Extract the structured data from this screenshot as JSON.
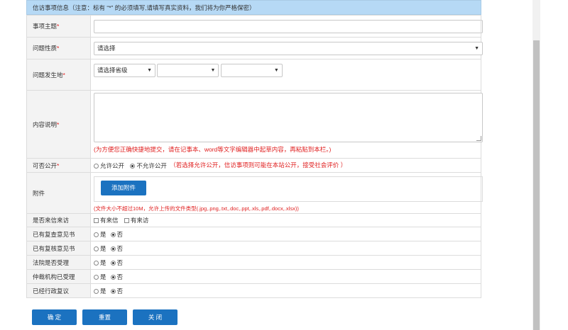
{
  "header": {
    "title": "信访事项信息（注意：标有 “*” 的必须填写,请填写真实资料，我们将为你严格保密）"
  },
  "fields": {
    "subject": {
      "label": "事项主题",
      "required": "*"
    },
    "nature": {
      "label": "问题性质",
      "required": "*",
      "selected": "请选择"
    },
    "location": {
      "label": "问题发生地",
      "required": "*",
      "province": "请选择省级",
      "city": "",
      "district": ""
    },
    "content": {
      "label": "内容说明",
      "required": "*",
      "hint": "(为方便您正确快捷地提交，请在记事本、word等文字编辑器中起草内容，再粘贴到本栏。)"
    },
    "public": {
      "label": "可否公开",
      "required": "*",
      "option_yes": "允许公开",
      "option_no": "不允许公开",
      "hint": "（若选择允许公开，信访事项则可能在本站公开，接受社会评价 ）"
    },
    "attachment": {
      "label": "附件",
      "button": "添加附件",
      "hint": "(文件大小不超过10M，允许上传的文件类型(.jpg,.png,.txt,.doc,.ppt,.xls,.pdf,.docx,.xlsx))"
    },
    "visited": {
      "label": "是否来信来访",
      "option_letter": "有来信",
      "option_visit": "有来访"
    }
  },
  "yes_no_rows": [
    {
      "label": "已有复查意见书",
      "yes": "是",
      "no": "否"
    },
    {
      "label": "已有复核意见书",
      "yes": "是",
      "no": "否"
    },
    {
      "label": "法院是否受理",
      "yes": "是",
      "no": "否"
    },
    {
      "label": "仲裁机构已受理",
      "yes": "是",
      "no": "否"
    },
    {
      "label": "已经行政复议",
      "yes": "是",
      "no": "否"
    }
  ],
  "buttons": {
    "confirm": "确 定",
    "reset": "重置",
    "close": "关 闭"
  },
  "colors": {
    "header_bg": "#b6d9f5",
    "button_bg": "#1b72c0",
    "required": "#e02020"
  }
}
